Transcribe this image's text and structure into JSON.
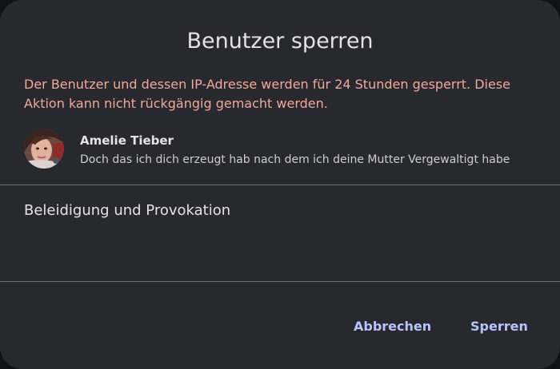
{
  "dialog": {
    "title": "Benutzer sperren",
    "warning": "Der Benutzer und dessen IP-Adresse werden für 24 Stunden gesperrt. Diese Aktion kann nicht rückgängig gemacht werden."
  },
  "user": {
    "name": "Amelie Tieber",
    "message": "Doch das ich dich erzeugt hab nach dem ich deine Mutter Vergewaltigt habe"
  },
  "reason": {
    "value": "Beleidigung und Provokation"
  },
  "actions": {
    "cancel_label": "Abbrechen",
    "confirm_label": "Sperren"
  },
  "colors": {
    "dialog_background": "#28292e",
    "warning_text": "#f2a89a",
    "accent": "#b8c3ff"
  }
}
